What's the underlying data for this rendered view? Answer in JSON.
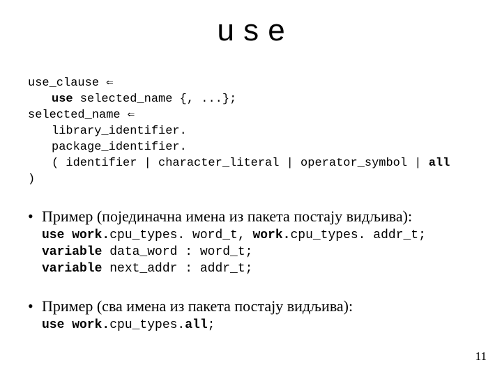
{
  "title": "use",
  "grammar": {
    "l1a": "use_clause ",
    "l1b": "⇐",
    "l2a": "use",
    "l2b": " selected_name ",
    "l2c": "{, ...}",
    "l2d": ";",
    "l3a": "selected_name ",
    "l3b": "⇐",
    "l4": "library_identifier.",
    "l5": "package_identifier.",
    "l6a": "( identifier | character_literal | operator_symbol | ",
    "l6b": "all",
    "l7": ")"
  },
  "bullet1": "Пример (појединачна имена из пакета постају видљива):",
  "ex1": {
    "l1a": "use work.",
    "l1b": "cpu_types. word_t, ",
    "l1c": "work.",
    "l1d": "cpu_types. addr_t;",
    "l2a": "variable ",
    "l2b": "data_word : word_t;",
    "l3a": "variable ",
    "l3b": "next_addr : addr_t;"
  },
  "bullet2": "Пример (сва имена из пакета постају видљива):",
  "ex2": {
    "l1a": "use work.",
    "l1b": "cpu_types.",
    "l1c": "all",
    "l1d": ";"
  },
  "page_number": "11"
}
